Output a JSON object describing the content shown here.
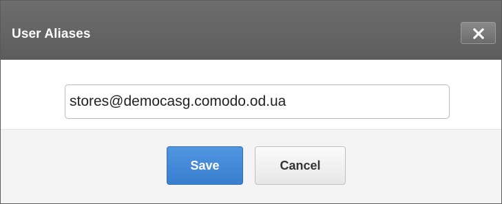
{
  "dialog": {
    "title": "User Aliases",
    "close_icon": "close-icon"
  },
  "form": {
    "alias_value": "stores@democasg.comodo.od.ua"
  },
  "actions": {
    "save_label": "Save",
    "cancel_label": "Cancel"
  },
  "colors": {
    "titlebar": "#636363",
    "save_button": "#3d83d3",
    "footer": "#f4f4f4"
  }
}
